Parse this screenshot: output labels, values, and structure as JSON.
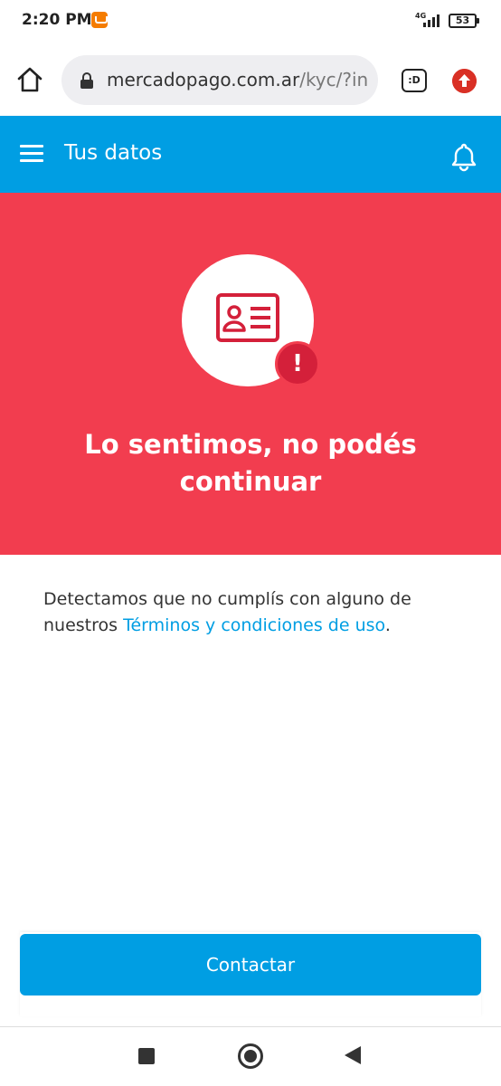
{
  "status_bar": {
    "time": "2:20 PM",
    "network": "4G",
    "battery": "53"
  },
  "browser": {
    "url_domain": "mercadopago.com.ar",
    "url_path": "/kyc/?in",
    "tabs_label": ":D"
  },
  "header": {
    "title": "Tus datos"
  },
  "hero": {
    "title": "Lo sentimos, no podés continuar",
    "badge": "!"
  },
  "message": {
    "text_before": "Detectamos que no cumplís con alguno de nuestros ",
    "link": "Términos y condiciones de uso",
    "text_after": "."
  },
  "actions": {
    "contact_label": "Contactar"
  },
  "colors": {
    "brand_blue": "#009ee3",
    "error_red": "#f23d4f",
    "icon_red": "#d4203a"
  }
}
